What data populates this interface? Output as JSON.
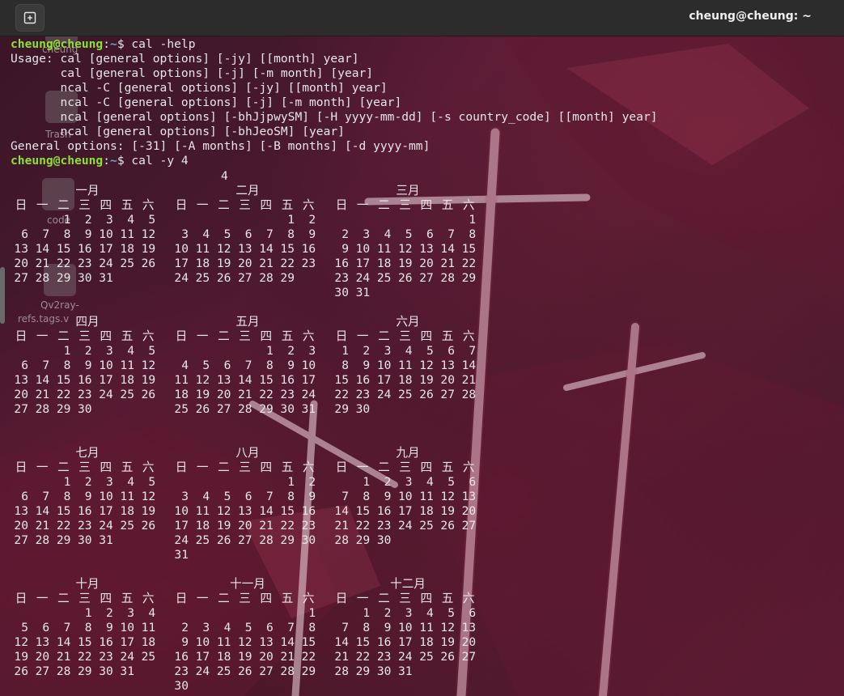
{
  "window": {
    "title": "cheung@cheung: ~"
  },
  "desktop": {
    "icons": [
      "cheung",
      "Trash",
      "code",
      "Qv2ray-",
      "refs.tags.v"
    ]
  },
  "terminal": {
    "lines": [
      {
        "user": "cheung@cheung",
        "path": "~",
        "cmd": "$ cal -help"
      },
      {
        "text": "Usage: cal [general options] [-jy] [[month] year]"
      },
      {
        "text": "       cal [general options] [-j] [-m month] [year]"
      },
      {
        "text": "       ncal -C [general options] [-jy] [[month] year]"
      },
      {
        "text": "       ncal -C [general options] [-j] [-m month] [year]"
      },
      {
        "text": "       ncal [general options] [-bhJjpwySM] [-H yyyy-mm-dd] [-s country_code] [[month] year]"
      },
      {
        "text": "       ncal [general options] [-bhJeoSM] [year]"
      },
      {
        "text": "General options: [-31] [-A months] [-B months] [-d yyyy-mm]"
      },
      {
        "user": "cheung@cheung",
        "path": "~",
        "cmd": "$ cal -y 4"
      }
    ]
  },
  "calendar": {
    "year": "4",
    "weekdays": [
      "日",
      "一",
      "二",
      "三",
      "四",
      "五",
      "六"
    ],
    "months": [
      {
        "name": "一月",
        "start": 2,
        "days": 31
      },
      {
        "name": "二月",
        "start": 5,
        "days": 29
      },
      {
        "name": "三月",
        "start": 6,
        "days": 31
      },
      {
        "name": "四月",
        "start": 2,
        "days": 30
      },
      {
        "name": "五月",
        "start": 4,
        "days": 31
      },
      {
        "name": "六月",
        "start": 0,
        "days": 30
      },
      {
        "name": "七月",
        "start": 2,
        "days": 31
      },
      {
        "name": "八月",
        "start": 5,
        "days": 31
      },
      {
        "name": "九月",
        "start": 1,
        "days": 30
      },
      {
        "name": "十月",
        "start": 3,
        "days": 31
      },
      {
        "name": "十一月",
        "start": 6,
        "days": 30
      },
      {
        "name": "十二月",
        "start": 1,
        "days": 31
      }
    ]
  },
  "colors": {
    "prompt_user": "#8ae234",
    "prompt_path": "#729fcf",
    "text": "#e8e6e6"
  }
}
